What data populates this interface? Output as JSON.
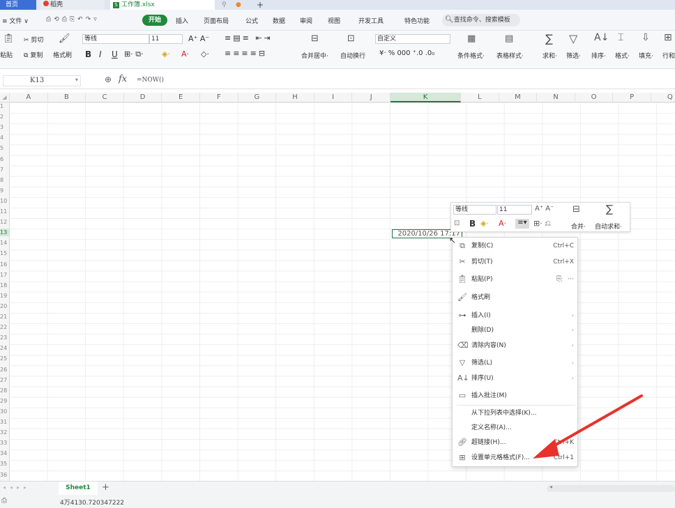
{
  "tabs": {
    "home": "首页",
    "docer": "稻壳",
    "workbook": "工作簿.xlsx",
    "new_tab": "+"
  },
  "menu": {
    "file": "≡ 文件 ∨",
    "start": "开始",
    "items": [
      "插入",
      "页面布局",
      "公式",
      "数据",
      "审阅",
      "视图",
      "开发工具",
      "特色功能"
    ],
    "search": "查找命令、搜索模板"
  },
  "ribbon": {
    "paste": "粘贴",
    "cut": "剪切",
    "copy": "复制",
    "format_painter": "格式刷",
    "font_name": "等线",
    "font_size": "11",
    "bold": "B",
    "italic": "I",
    "underline": "U",
    "merge_center": "合并居中",
    "auto_wrap": "自动换行",
    "number_format": "自定义",
    "currency": "¥",
    "percent": "%",
    "thousands": "000",
    "cond_format": "条件格式",
    "table_style": "表格样式",
    "sum": "求和",
    "filter": "筛选",
    "sort": "排序",
    "format": "格式",
    "fill": "填充",
    "row_col": "行和"
  },
  "formula_bar": {
    "name_box": "K13",
    "fx": "fx",
    "formula": "=NOW()"
  },
  "columns": [
    "A",
    "B",
    "C",
    "D",
    "E",
    "F",
    "G",
    "H",
    "I",
    "J",
    "K",
    "L",
    "M",
    "N",
    "O",
    "P",
    "Q"
  ],
  "rows": [
    "1",
    "2",
    "3",
    "4",
    "5",
    "6",
    "7",
    "8",
    "9",
    "10",
    "11",
    "12",
    "13",
    "14",
    "15",
    "16",
    "17",
    "18",
    "19",
    "20",
    "21",
    "22",
    "23",
    "24",
    "25",
    "26",
    "27",
    "28",
    "29",
    "30",
    "31",
    "32",
    "33",
    "34",
    "35",
    "36"
  ],
  "cell_k13": "2020/10/26 17:17",
  "mini_toolbar": {
    "font": "等线",
    "size": "11",
    "merge": "合并",
    "autosum": "自动求和",
    "bold": "B"
  },
  "context_menu": [
    {
      "label": "复制(C)",
      "shortcut": "Ctrl+C",
      "icon": "copy-icon"
    },
    {
      "label": "剪切(T)",
      "shortcut": "Ctrl+X",
      "icon": "scissors-icon"
    },
    {
      "label": "粘贴(P)",
      "shortcut": "···",
      "icon": "paste-icon"
    },
    {
      "label": "格式刷",
      "shortcut": "",
      "icon": "format-painter-icon"
    },
    {
      "label": "插入(I)",
      "shortcut": "",
      "icon": "insert-icon"
    },
    {
      "label": "删除(D)",
      "shortcut": "",
      "icon": ""
    },
    {
      "label": "清除内容(N)",
      "shortcut": "",
      "icon": "eraser-icon"
    },
    {
      "label": "筛选(L)",
      "shortcut": "",
      "icon": "filter-icon"
    },
    {
      "label": "排序(U)",
      "shortcut": "",
      "icon": "sort-icon"
    },
    {
      "label": "插入批注(M)",
      "shortcut": "",
      "icon": "comment-icon"
    },
    {
      "label": "从下拉列表中选择(K)...",
      "shortcut": "",
      "icon": ""
    },
    {
      "label": "定义名称(A)...",
      "shortcut": "",
      "icon": ""
    },
    {
      "label": "超链接(H)...",
      "shortcut": "Ctrl+K",
      "icon": "link-icon"
    },
    {
      "label": "设置单元格格式(F)...",
      "shortcut": "Ctrl+1",
      "icon": "format-cells-icon"
    }
  ],
  "sheet": {
    "name": "Sheet1",
    "add": "+"
  },
  "status": {
    "value": "4万4130.720347222"
  },
  "colors": {
    "start_green": "#1f8a3c",
    "arrow_red": "#e8322b",
    "selection_green": "#217346"
  }
}
